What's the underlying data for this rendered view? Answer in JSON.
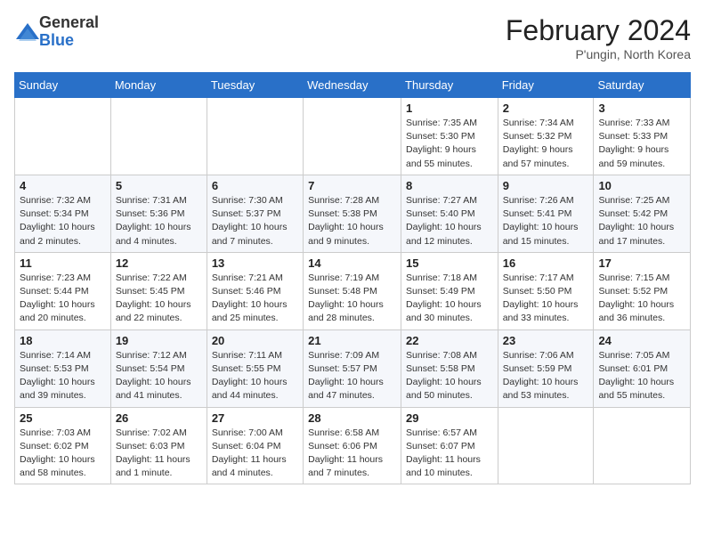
{
  "header": {
    "logo_general": "General",
    "logo_blue": "Blue",
    "month_title": "February 2024",
    "location": "P'ungin, North Korea"
  },
  "weekdays": [
    "Sunday",
    "Monday",
    "Tuesday",
    "Wednesday",
    "Thursday",
    "Friday",
    "Saturday"
  ],
  "weeks": [
    [
      {
        "day": "",
        "info": ""
      },
      {
        "day": "",
        "info": ""
      },
      {
        "day": "",
        "info": ""
      },
      {
        "day": "",
        "info": ""
      },
      {
        "day": "1",
        "info": "Sunrise: 7:35 AM\nSunset: 5:30 PM\nDaylight: 9 hours\nand 55 minutes."
      },
      {
        "day": "2",
        "info": "Sunrise: 7:34 AM\nSunset: 5:32 PM\nDaylight: 9 hours\nand 57 minutes."
      },
      {
        "day": "3",
        "info": "Sunrise: 7:33 AM\nSunset: 5:33 PM\nDaylight: 9 hours\nand 59 minutes."
      }
    ],
    [
      {
        "day": "4",
        "info": "Sunrise: 7:32 AM\nSunset: 5:34 PM\nDaylight: 10 hours\nand 2 minutes."
      },
      {
        "day": "5",
        "info": "Sunrise: 7:31 AM\nSunset: 5:36 PM\nDaylight: 10 hours\nand 4 minutes."
      },
      {
        "day": "6",
        "info": "Sunrise: 7:30 AM\nSunset: 5:37 PM\nDaylight: 10 hours\nand 7 minutes."
      },
      {
        "day": "7",
        "info": "Sunrise: 7:28 AM\nSunset: 5:38 PM\nDaylight: 10 hours\nand 9 minutes."
      },
      {
        "day": "8",
        "info": "Sunrise: 7:27 AM\nSunset: 5:40 PM\nDaylight: 10 hours\nand 12 minutes."
      },
      {
        "day": "9",
        "info": "Sunrise: 7:26 AM\nSunset: 5:41 PM\nDaylight: 10 hours\nand 15 minutes."
      },
      {
        "day": "10",
        "info": "Sunrise: 7:25 AM\nSunset: 5:42 PM\nDaylight: 10 hours\nand 17 minutes."
      }
    ],
    [
      {
        "day": "11",
        "info": "Sunrise: 7:23 AM\nSunset: 5:44 PM\nDaylight: 10 hours\nand 20 minutes."
      },
      {
        "day": "12",
        "info": "Sunrise: 7:22 AM\nSunset: 5:45 PM\nDaylight: 10 hours\nand 22 minutes."
      },
      {
        "day": "13",
        "info": "Sunrise: 7:21 AM\nSunset: 5:46 PM\nDaylight: 10 hours\nand 25 minutes."
      },
      {
        "day": "14",
        "info": "Sunrise: 7:19 AM\nSunset: 5:48 PM\nDaylight: 10 hours\nand 28 minutes."
      },
      {
        "day": "15",
        "info": "Sunrise: 7:18 AM\nSunset: 5:49 PM\nDaylight: 10 hours\nand 30 minutes."
      },
      {
        "day": "16",
        "info": "Sunrise: 7:17 AM\nSunset: 5:50 PM\nDaylight: 10 hours\nand 33 minutes."
      },
      {
        "day": "17",
        "info": "Sunrise: 7:15 AM\nSunset: 5:52 PM\nDaylight: 10 hours\nand 36 minutes."
      }
    ],
    [
      {
        "day": "18",
        "info": "Sunrise: 7:14 AM\nSunset: 5:53 PM\nDaylight: 10 hours\nand 39 minutes."
      },
      {
        "day": "19",
        "info": "Sunrise: 7:12 AM\nSunset: 5:54 PM\nDaylight: 10 hours\nand 41 minutes."
      },
      {
        "day": "20",
        "info": "Sunrise: 7:11 AM\nSunset: 5:55 PM\nDaylight: 10 hours\nand 44 minutes."
      },
      {
        "day": "21",
        "info": "Sunrise: 7:09 AM\nSunset: 5:57 PM\nDaylight: 10 hours\nand 47 minutes."
      },
      {
        "day": "22",
        "info": "Sunrise: 7:08 AM\nSunset: 5:58 PM\nDaylight: 10 hours\nand 50 minutes."
      },
      {
        "day": "23",
        "info": "Sunrise: 7:06 AM\nSunset: 5:59 PM\nDaylight: 10 hours\nand 53 minutes."
      },
      {
        "day": "24",
        "info": "Sunrise: 7:05 AM\nSunset: 6:01 PM\nDaylight: 10 hours\nand 55 minutes."
      }
    ],
    [
      {
        "day": "25",
        "info": "Sunrise: 7:03 AM\nSunset: 6:02 PM\nDaylight: 10 hours\nand 58 minutes."
      },
      {
        "day": "26",
        "info": "Sunrise: 7:02 AM\nSunset: 6:03 PM\nDaylight: 11 hours\nand 1 minute."
      },
      {
        "day": "27",
        "info": "Sunrise: 7:00 AM\nSunset: 6:04 PM\nDaylight: 11 hours\nand 4 minutes."
      },
      {
        "day": "28",
        "info": "Sunrise: 6:58 AM\nSunset: 6:06 PM\nDaylight: 11 hours\nand 7 minutes."
      },
      {
        "day": "29",
        "info": "Sunrise: 6:57 AM\nSunset: 6:07 PM\nDaylight: 11 hours\nand 10 minutes."
      },
      {
        "day": "",
        "info": ""
      },
      {
        "day": "",
        "info": ""
      }
    ]
  ]
}
